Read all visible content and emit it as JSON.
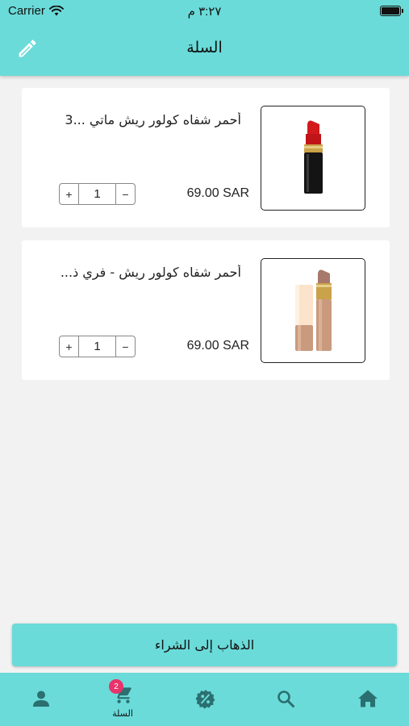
{
  "status_bar": {
    "carrier": "Carrier",
    "time": "٣:٢٧ م"
  },
  "header": {
    "title": "السلة"
  },
  "cart_items": [
    {
      "name": "أحمر شفاه  كولور ريش ماتي ...3",
      "price": "69.00 SAR",
      "quantity": "1",
      "image": "red-lipstick"
    },
    {
      "name": "أحمر شفاه كولور ريش - فري  ذ...",
      "price": "69.00 SAR",
      "quantity": "1",
      "image": "nude-lipstick"
    }
  ],
  "stepper": {
    "plus": "+",
    "minus": "−"
  },
  "checkout": {
    "label": "الذهاب إلى الشراء"
  },
  "tab_bar": {
    "items": [
      {
        "icon": "person-icon",
        "label": ""
      },
      {
        "icon": "cart-icon",
        "label": "السلة",
        "badge": "2"
      },
      {
        "icon": "discount-icon",
        "label": ""
      },
      {
        "icon": "search-icon",
        "label": ""
      },
      {
        "icon": "home-icon",
        "label": ""
      }
    ]
  },
  "colors": {
    "accent": "#6adbd9",
    "badge": "#e8336b",
    "background": "#f2f2f2"
  }
}
